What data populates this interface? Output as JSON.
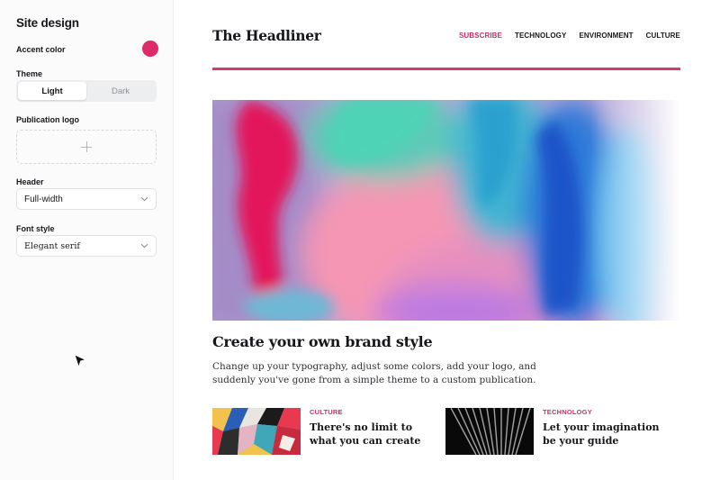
{
  "sidebar": {
    "title": "Site design",
    "accent_label": "Accent color",
    "accent_color": "#dd2a68",
    "theme_label": "Theme",
    "theme_options": [
      "Light",
      "Dark"
    ],
    "theme_selected": "Light",
    "logo_label": "Publication logo",
    "header_label": "Header",
    "header_value": "Full-width",
    "font_label": "Font style",
    "font_value": "Elegant serif"
  },
  "preview": {
    "site_title": "The Headliner",
    "nav": [
      "SUBSCRIBE",
      "TECHNOLOGY",
      "ENVIRONMENT",
      "CULTURE"
    ],
    "headline": "Create your own brand style",
    "excerpt": "Change up your typography, adjust some colors, add your logo, and suddenly you've gone from a simple theme to a custom publication.",
    "cards": [
      {
        "tag": "CULTURE",
        "title": "There's no limit to what you can create"
      },
      {
        "tag": "TECHNOLOGY",
        "title": "Let your imagination be your guide"
      }
    ]
  },
  "icons": [
    "plus-icon",
    "chevron-down-icon",
    "mouse-cursor-icon"
  ]
}
